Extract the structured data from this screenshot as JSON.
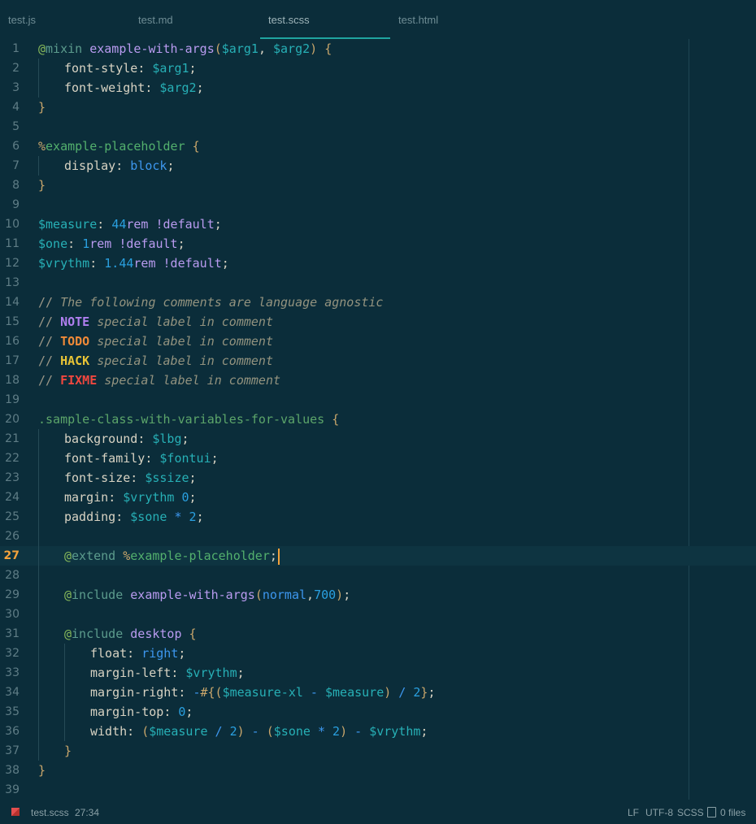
{
  "tabs": [
    {
      "label": "test.js",
      "active": false
    },
    {
      "label": "test.md",
      "active": false
    },
    {
      "label": "test.scss",
      "active": true
    },
    {
      "label": "test.html",
      "active": false
    }
  ],
  "editor": {
    "current_line": 27,
    "lines": [
      {
        "n": "1",
        "tokens": [
          [
            "at",
            "@"
          ],
          [
            "kw",
            "mixin "
          ],
          [
            "fn",
            "example-with-args"
          ],
          [
            "punc",
            "("
          ],
          [
            "var",
            "$arg1"
          ],
          [
            "prop",
            ", "
          ],
          [
            "var",
            "$arg2"
          ],
          [
            "punc",
            ") {"
          ]
        ]
      },
      {
        "n": "2",
        "indent": 1,
        "tokens": [
          [
            "prop",
            "font-style"
          ],
          [
            "prop",
            ": "
          ],
          [
            "var",
            "$arg1"
          ],
          [
            "prop",
            ";"
          ]
        ]
      },
      {
        "n": "3",
        "indent": 1,
        "tokens": [
          [
            "prop",
            "font-weight"
          ],
          [
            "prop",
            ": "
          ],
          [
            "var",
            "$arg2"
          ],
          [
            "prop",
            ";"
          ]
        ]
      },
      {
        "n": "4",
        "tokens": [
          [
            "punc",
            "}"
          ]
        ]
      },
      {
        "n": "5",
        "tokens": []
      },
      {
        "n": "6",
        "tokens": [
          [
            "punc",
            "%"
          ],
          [
            "ph",
            "example-placeholder"
          ],
          [
            "punc",
            " {"
          ]
        ]
      },
      {
        "n": "7",
        "indent": 1,
        "tokens": [
          [
            "prop",
            "display"
          ],
          [
            "prop",
            ": "
          ],
          [
            "val",
            "block"
          ],
          [
            "prop",
            ";"
          ]
        ]
      },
      {
        "n": "8",
        "tokens": [
          [
            "punc",
            "}"
          ]
        ]
      },
      {
        "n": "9",
        "tokens": []
      },
      {
        "n": "10",
        "tokens": [
          [
            "var",
            "$measure"
          ],
          [
            "prop",
            ": "
          ],
          [
            "num",
            "44"
          ],
          [
            "unit",
            "rem"
          ],
          [
            "def",
            " !default"
          ],
          [
            "prop",
            ";"
          ]
        ]
      },
      {
        "n": "11",
        "tokens": [
          [
            "var",
            "$one"
          ],
          [
            "prop",
            ": "
          ],
          [
            "num",
            "1"
          ],
          [
            "unit",
            "rem"
          ],
          [
            "def",
            " !default"
          ],
          [
            "prop",
            ";"
          ]
        ]
      },
      {
        "n": "12",
        "tokens": [
          [
            "var",
            "$vrythm"
          ],
          [
            "prop",
            ": "
          ],
          [
            "num",
            "1.44"
          ],
          [
            "unit",
            "rem"
          ],
          [
            "def",
            " !default"
          ],
          [
            "prop",
            ";"
          ]
        ]
      },
      {
        "n": "13",
        "tokens": []
      },
      {
        "n": "14",
        "tokens": [
          [
            "slash",
            "// "
          ],
          [
            "com",
            "The following comments are language agnostic"
          ]
        ]
      },
      {
        "n": "15",
        "tokens": [
          [
            "slash",
            "// "
          ],
          [
            "note",
            "NOTE"
          ],
          [
            "com",
            " special label in comment"
          ]
        ]
      },
      {
        "n": "16",
        "tokens": [
          [
            "slash",
            "// "
          ],
          [
            "todo",
            "TODO"
          ],
          [
            "com",
            " special label in comment"
          ]
        ]
      },
      {
        "n": "17",
        "tokens": [
          [
            "slash",
            "// "
          ],
          [
            "hack",
            "HACK"
          ],
          [
            "com",
            " special label in comment"
          ]
        ]
      },
      {
        "n": "18",
        "tokens": [
          [
            "slash",
            "// "
          ],
          [
            "fixme",
            "FIXME"
          ],
          [
            "com",
            " special label in comment"
          ]
        ]
      },
      {
        "n": "19",
        "tokens": []
      },
      {
        "n": "20",
        "tokens": [
          [
            "cls",
            ".sample-class-with-variables-for-values"
          ],
          [
            "punc",
            " {"
          ]
        ]
      },
      {
        "n": "21",
        "indent": 1,
        "tokens": [
          [
            "prop",
            "background"
          ],
          [
            "prop",
            ": "
          ],
          [
            "var",
            "$lbg"
          ],
          [
            "prop",
            ";"
          ]
        ]
      },
      {
        "n": "22",
        "indent": 1,
        "tokens": [
          [
            "prop",
            "font-family"
          ],
          [
            "prop",
            ": "
          ],
          [
            "var",
            "$fontui"
          ],
          [
            "prop",
            ";"
          ]
        ]
      },
      {
        "n": "23",
        "indent": 1,
        "tokens": [
          [
            "prop",
            "font-size"
          ],
          [
            "prop",
            ": "
          ],
          [
            "var",
            "$ssize"
          ],
          [
            "prop",
            ";"
          ]
        ]
      },
      {
        "n": "24",
        "indent": 1,
        "tokens": [
          [
            "prop",
            "margin"
          ],
          [
            "prop",
            ": "
          ],
          [
            "var",
            "$vrythm"
          ],
          [
            "num",
            " 0"
          ],
          [
            "prop",
            ";"
          ]
        ]
      },
      {
        "n": "25",
        "indent": 1,
        "tokens": [
          [
            "prop",
            "padding"
          ],
          [
            "prop",
            ": "
          ],
          [
            "var",
            "$sone"
          ],
          [
            "op",
            " * "
          ],
          [
            "num",
            "2"
          ],
          [
            "prop",
            ";"
          ]
        ]
      },
      {
        "n": "26",
        "indent": 1,
        "tokens": []
      },
      {
        "n": "27",
        "indent": 1,
        "cursor": true,
        "tokens": [
          [
            "at",
            "@"
          ],
          [
            "kw",
            "extend "
          ],
          [
            "punc",
            "%"
          ],
          [
            "ph",
            "example-placeholder"
          ],
          [
            "prop",
            ";"
          ]
        ]
      },
      {
        "n": "28",
        "indent": 1,
        "tokens": []
      },
      {
        "n": "29",
        "indent": 1,
        "tokens": [
          [
            "at",
            "@"
          ],
          [
            "kw",
            "include "
          ],
          [
            "fn",
            "example-with-args"
          ],
          [
            "punc",
            "("
          ],
          [
            "val",
            "normal"
          ],
          [
            "prop",
            ","
          ],
          [
            "num",
            "700"
          ],
          [
            "punc",
            ")"
          ],
          [
            "prop",
            ";"
          ]
        ]
      },
      {
        "n": "30",
        "indent": 1,
        "tokens": []
      },
      {
        "n": "31",
        "indent": 1,
        "tokens": [
          [
            "at",
            "@"
          ],
          [
            "kw",
            "include "
          ],
          [
            "fn",
            "desktop"
          ],
          [
            "punc",
            " {"
          ]
        ]
      },
      {
        "n": "32",
        "indent": 2,
        "tokens": [
          [
            "prop",
            "float"
          ],
          [
            "prop",
            ": "
          ],
          [
            "val",
            "right"
          ],
          [
            "prop",
            ";"
          ]
        ]
      },
      {
        "n": "33",
        "indent": 2,
        "tokens": [
          [
            "prop",
            "margin-left"
          ],
          [
            "prop",
            ": "
          ],
          [
            "var",
            "$vrythm"
          ],
          [
            "prop",
            ";"
          ]
        ]
      },
      {
        "n": "34",
        "indent": 2,
        "tokens": [
          [
            "prop",
            "margin-right"
          ],
          [
            "prop",
            ": "
          ],
          [
            "op",
            "-"
          ],
          [
            "interp",
            "#{("
          ],
          [
            "var",
            "$measure-xl"
          ],
          [
            "op",
            " - "
          ],
          [
            "var",
            "$measure"
          ],
          [
            "interp",
            ")"
          ],
          [
            "op",
            " / "
          ],
          [
            "num",
            "2"
          ],
          [
            "interp",
            "}"
          ],
          [
            "prop",
            ";"
          ]
        ]
      },
      {
        "n": "35",
        "indent": 2,
        "tokens": [
          [
            "prop",
            "margin-top"
          ],
          [
            "prop",
            ": "
          ],
          [
            "num",
            "0"
          ],
          [
            "prop",
            ";"
          ]
        ]
      },
      {
        "n": "36",
        "indent": 2,
        "tokens": [
          [
            "prop",
            "width"
          ],
          [
            "prop",
            ": "
          ],
          [
            "punc",
            "("
          ],
          [
            "var",
            "$measure"
          ],
          [
            "op",
            " / "
          ],
          [
            "num",
            "2"
          ],
          [
            "punc",
            ")"
          ],
          [
            "op",
            " - "
          ],
          [
            "punc",
            "("
          ],
          [
            "var",
            "$sone"
          ],
          [
            "op",
            " * "
          ],
          [
            "num",
            "2"
          ],
          [
            "punc",
            ")"
          ],
          [
            "op",
            " - "
          ],
          [
            "var",
            "$vrythm"
          ],
          [
            "prop",
            ";"
          ]
        ]
      },
      {
        "n": "37",
        "indent": 1,
        "tokens": [
          [
            "punc",
            "}"
          ]
        ]
      },
      {
        "n": "38",
        "tokens": [
          [
            "punc",
            "}"
          ]
        ]
      },
      {
        "n": "39",
        "tokens": []
      }
    ]
  },
  "status": {
    "filename": "test.scss",
    "position": "27:34",
    "line_ending": "LF",
    "encoding": "UTF-8",
    "grammar": "SCSS",
    "files": "0 files"
  }
}
